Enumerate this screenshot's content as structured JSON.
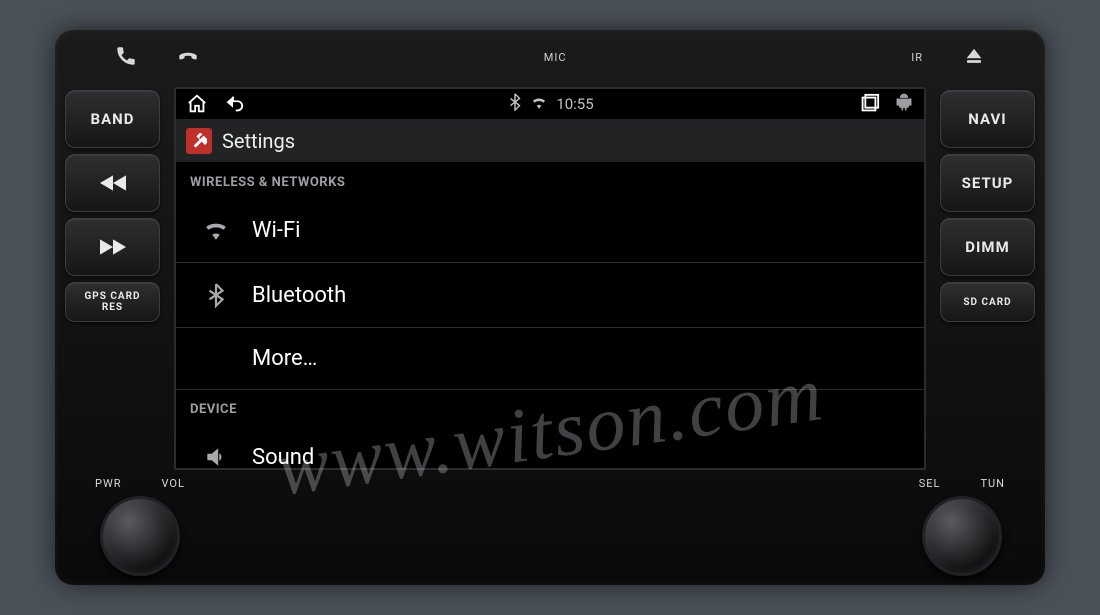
{
  "statusbar": {
    "time": "10:55",
    "bt_icon": "bluetooth-icon",
    "android_icon": "android-icon"
  },
  "navbar": {
    "home": "home-icon",
    "back": "back-icon",
    "recents": "recents-icon"
  },
  "header": {
    "title": "Settings"
  },
  "sections": [
    {
      "header": "WIRELESS & NETWORKS",
      "items": [
        {
          "icon": "wifi-icon",
          "label": "Wi-Fi"
        },
        {
          "icon": "bluetooth-icon",
          "label": "Bluetooth"
        },
        {
          "icon": "",
          "label": "More…",
          "indent": true
        }
      ]
    },
    {
      "header": "DEVICE",
      "items": [
        {
          "icon": "sound-icon",
          "label": "Sound"
        }
      ]
    }
  ],
  "hard_buttons": {
    "left": [
      "BAND",
      "◄◄",
      "►►",
      "GPS CARD\nRES"
    ],
    "right": [
      "NAVI",
      "SETUP",
      "DIMM",
      "SD CARD"
    ]
  },
  "top_strip": {
    "mic": "MIC",
    "ir": "IR"
  },
  "knobs": {
    "left": [
      "PWR",
      "VOL"
    ],
    "right": [
      "SEL",
      "TUN"
    ]
  },
  "watermark": "www.witson.com"
}
